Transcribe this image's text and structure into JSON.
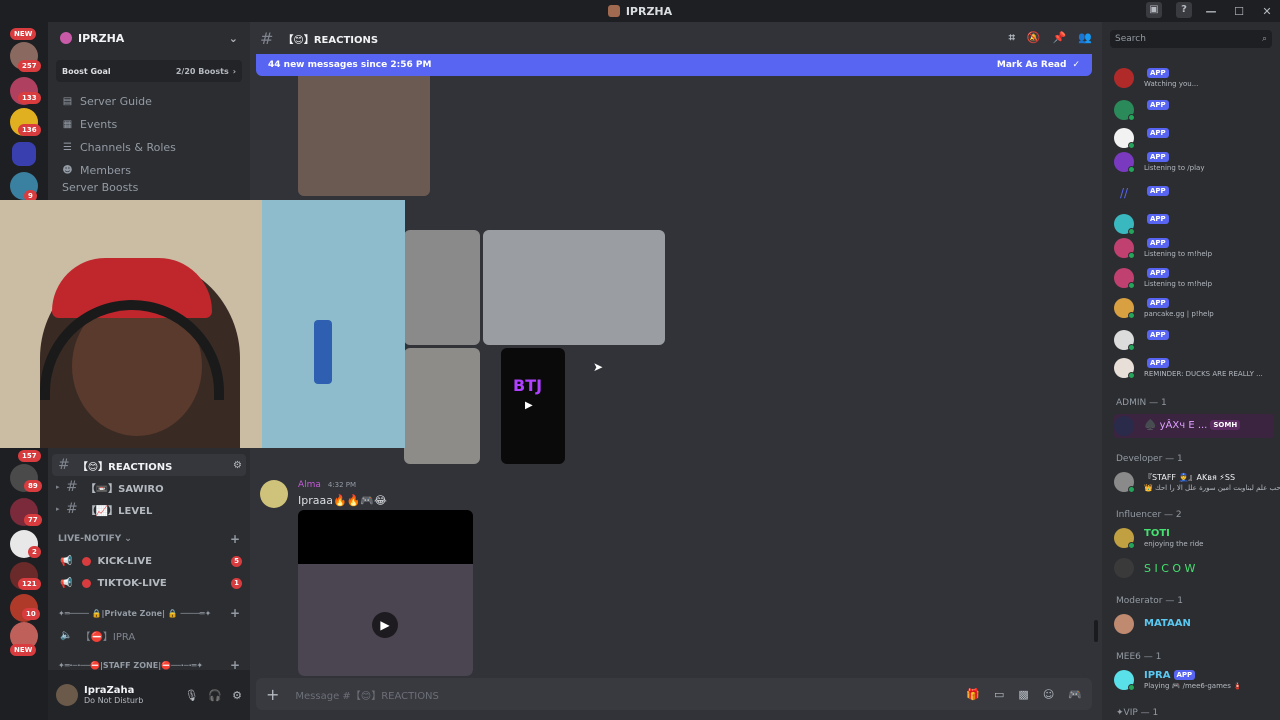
{
  "window": {
    "title": "IPRZHA"
  },
  "rail": {
    "badges": [
      "NEW",
      "257",
      "133",
      "136",
      "9",
      "157",
      "89",
      "77",
      "2",
      "121",
      "10",
      "NEW"
    ]
  },
  "sidebar": {
    "server_name": "IPRZHA",
    "boost_label": "Boost Goal",
    "boost_count": "2/20 Boosts",
    "nav": [
      {
        "label": "Server Guide",
        "icon": "guide-icon"
      },
      {
        "label": "Events",
        "icon": "calendar-icon"
      },
      {
        "label": "Channels & Roles",
        "icon": "channels-icon"
      },
      {
        "label": "Members",
        "icon": "members-icon"
      }
    ],
    "partial_nav": "Server Boosts",
    "channels": [
      {
        "label": "【😊】REACTIONS",
        "active": true
      },
      {
        "label": "【📼】SAWIRO",
        "active": false
      },
      {
        "label": "【📈】LEVEL",
        "active": false
      }
    ],
    "category_live": "LIVE-NOTIFY",
    "live_channels": [
      {
        "label": "KICK-LIVE",
        "count": "5"
      },
      {
        "label": "TIKTOK-LIVE",
        "count": "1"
      }
    ],
    "category_private": "✦═──── 🔒|Private Zone| 🔒 ────═✦",
    "private_channel": "【⛔】IPRA",
    "category_staff": "✦═·─·──⛔|STAFF ZONE|⛔──·─·═✦",
    "user": {
      "name": "IpraZaha",
      "status": "Do Not Disturb"
    }
  },
  "main": {
    "channel_title": "【😊】REACTIONS",
    "new_messages": "44 new messages since 2:56 PM",
    "mark_as_read": "Mark As Read",
    "message": {
      "author": "Alma",
      "time": "4:32 PM",
      "text": "Ipraaa🔥🔥🎮😂"
    },
    "composer_placeholder": "Message #【😊】REACTIONS",
    "thumb_text": "BTJ"
  },
  "members": {
    "search_placeholder": "Search",
    "bots": [
      {
        "name": "",
        "app": "APP",
        "sub": "Watching you..."
      },
      {
        "name": "",
        "app": "APP",
        "sub": ""
      },
      {
        "name": "",
        "app": "APP",
        "sub": ""
      },
      {
        "name": "",
        "app": "APP",
        "sub": "Listening to /play"
      },
      {
        "name": "",
        "app": "APP",
        "sub": ""
      },
      {
        "name": "",
        "app": "APP",
        "sub": ""
      },
      {
        "name": "",
        "app": "APP",
        "sub": "Listening to m!help"
      },
      {
        "name": "",
        "app": "APP",
        "sub": "Listening to m!help"
      },
      {
        "name": "",
        "app": "APP",
        "sub": "pancake.gg | p!help"
      },
      {
        "name": "",
        "app": "APP",
        "sub": ""
      },
      {
        "name": "",
        "app": "APP",
        "sub": "REMINDER: DUCKS ARE REALLY ..."
      }
    ],
    "roles": [
      {
        "label": "ADMIN — 1",
        "members": [
          {
            "name": "♠️ yÂXч E ...",
            "sub": "",
            "tag": "SOMH"
          }
        ]
      },
      {
        "label": "Developer — 1",
        "members": [
          {
            "name": "『STAFF 👮』AKвя ⚡SS",
            "sub": "👑 حب علم لبناوبت امين سورة علل الا را احك"
          }
        ]
      },
      {
        "label": "Influencer — 2",
        "members": [
          {
            "name": "TOTI",
            "sub": "enjoying the ride"
          },
          {
            "name": "S I C O W",
            "sub": ""
          }
        ]
      },
      {
        "label": "Moderator — 1",
        "members": [
          {
            "name": "MATAAN",
            "sub": ""
          }
        ]
      },
      {
        "label": "MEE6 — 1",
        "members": [
          {
            "name": "IPRA",
            "sub": "Playing 🎮 /mee6-games 🧯",
            "tag": "APP"
          }
        ]
      }
    ],
    "partial_role": "✦VIP — 1"
  }
}
